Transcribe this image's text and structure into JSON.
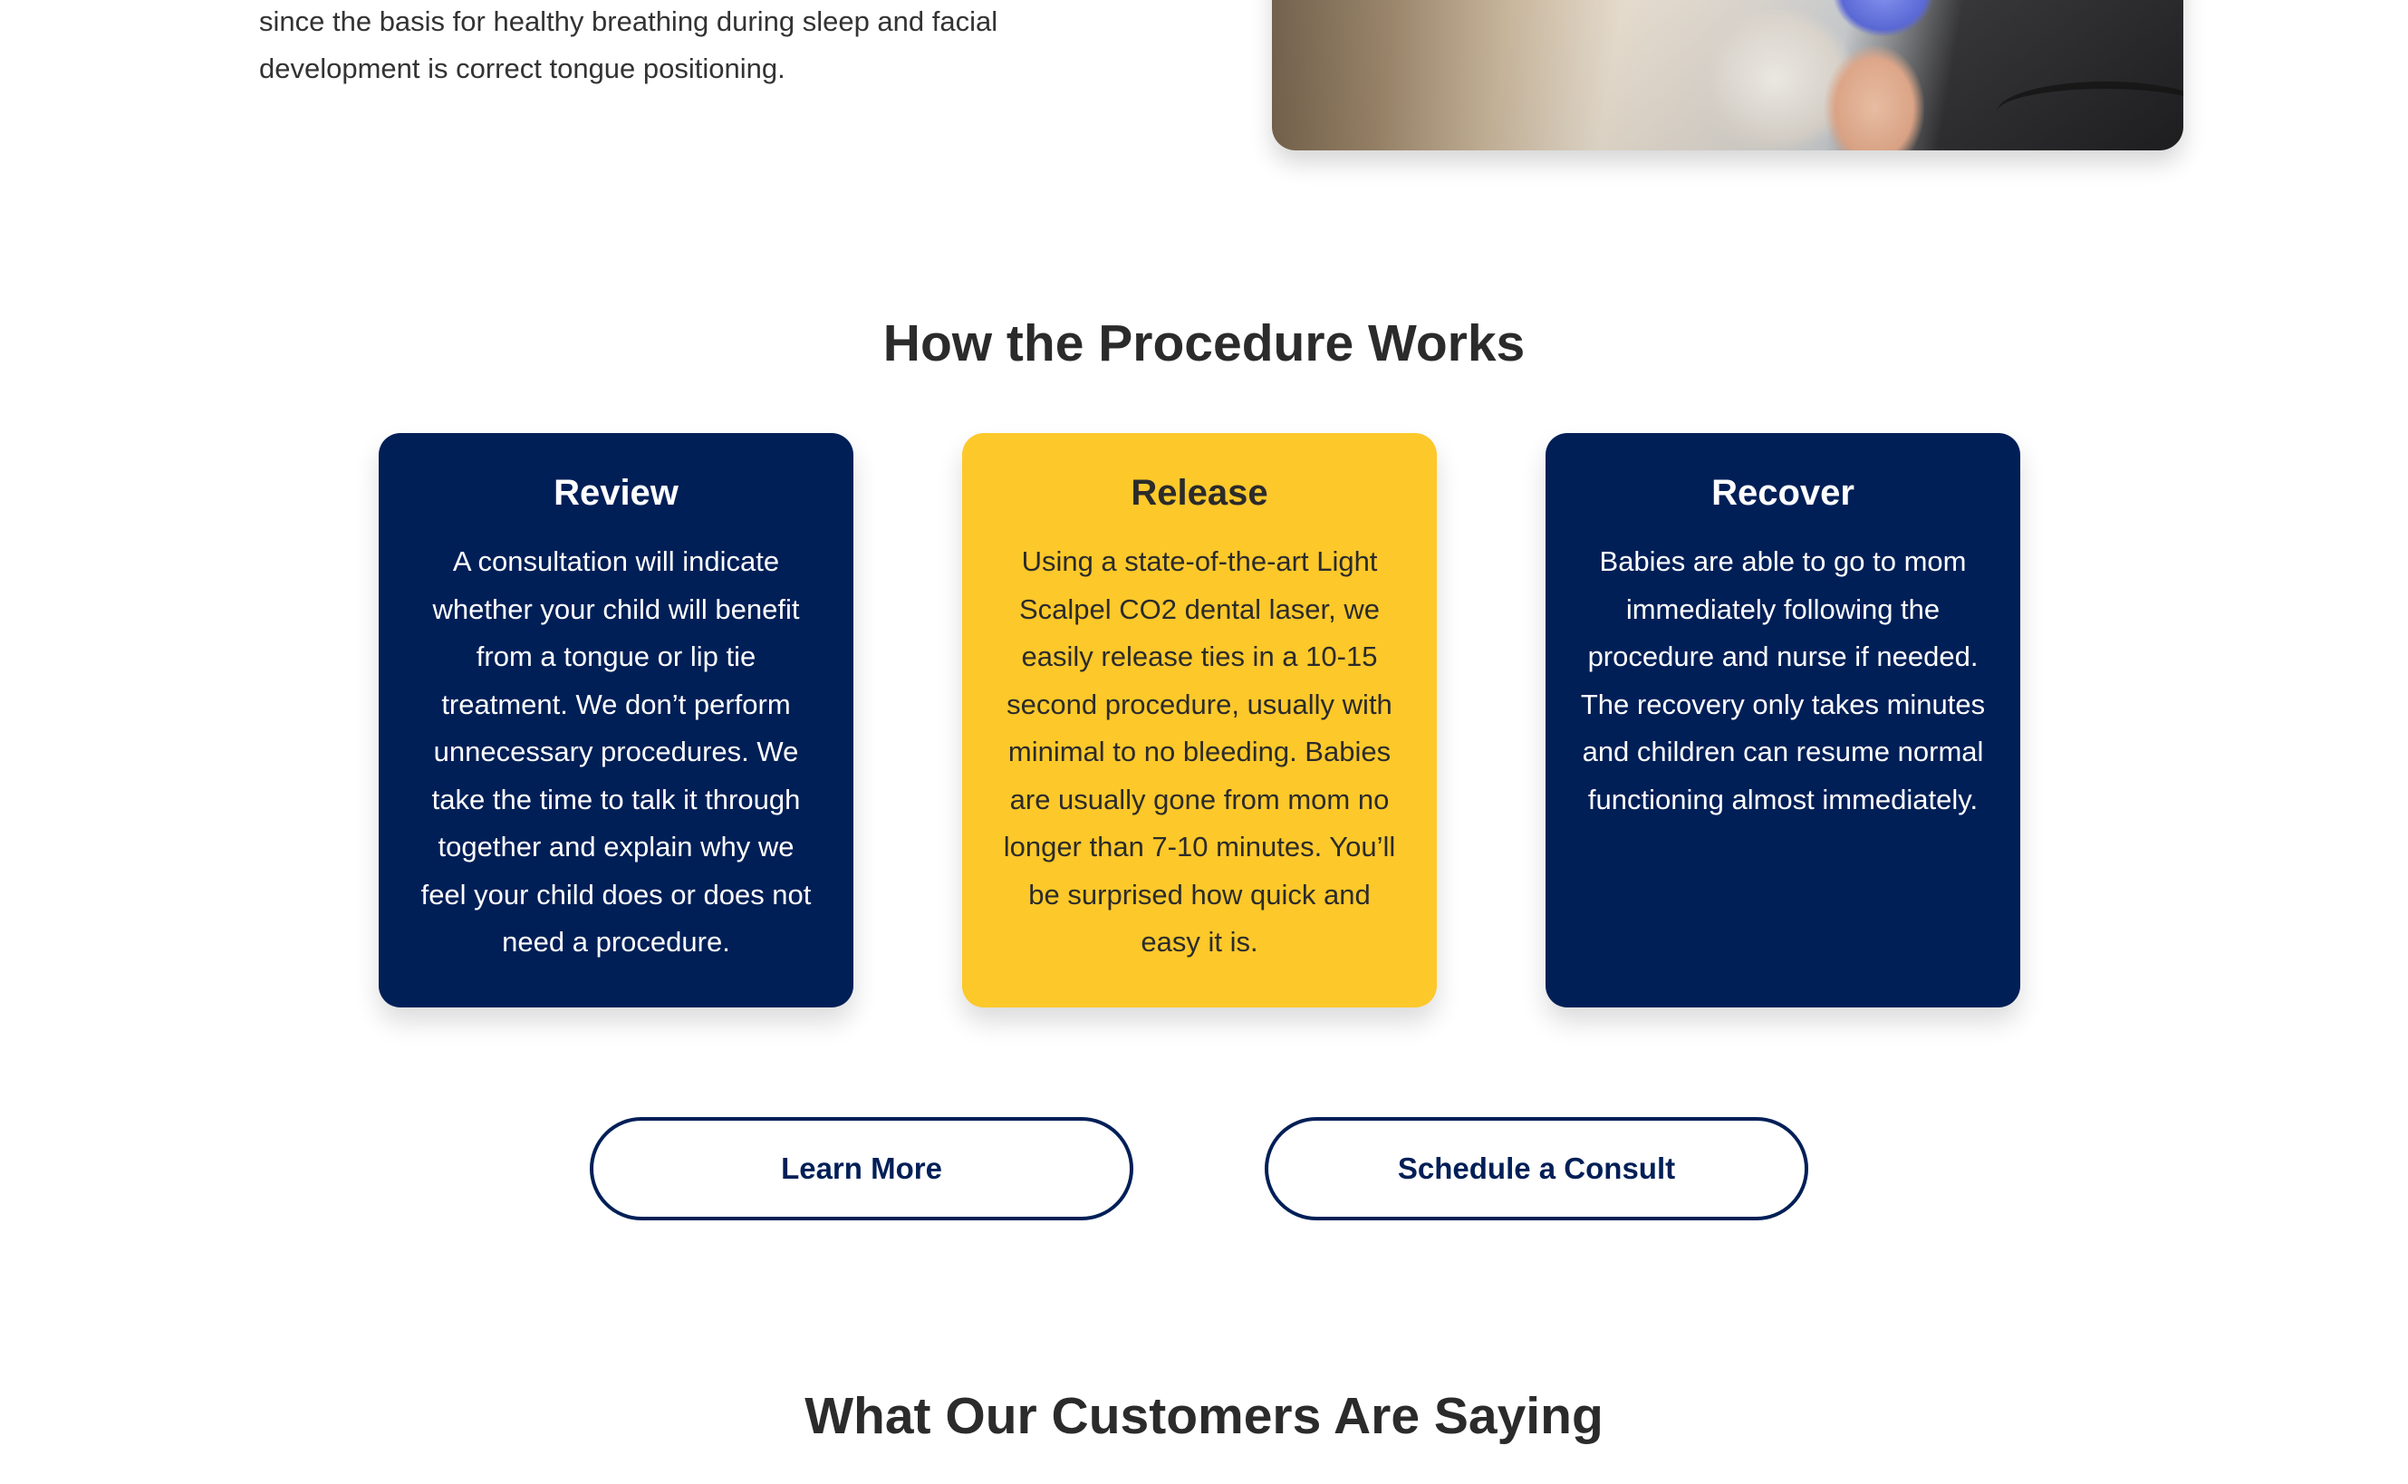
{
  "intro": {
    "text": "since the basis for healthy breathing during sleep and facial development is correct tongue positioning."
  },
  "procedure": {
    "title": "How the Procedure Works",
    "cards": [
      {
        "title": "Review",
        "body": "A consultation will indicate whether your child will benefit from a tongue or lip tie treatment. We don’t perform unnecessary procedures. We take the time to talk it through together and explain why we feel your child does or does not need a procedure."
      },
      {
        "title": "Release",
        "body": "Using a state-of-the-art Light Scalpel CO2 dental laser, we easily release ties in a 10-15 second procedure, usually with minimal to no bleeding. Babies are usually gone from mom no longer than 7-10 minutes. You’ll be surprised how quick and easy it is."
      },
      {
        "title": "Recover",
        "body": "Babies are able to go to mom immediately following the procedure and nurse if needed. The recovery only takes minutes and children can resume normal functioning almost immediately."
      }
    ],
    "buttons": {
      "learn_more": "Learn More",
      "schedule": "Schedule a Consult"
    }
  },
  "testimonials": {
    "title": "What Our Customers Are Saying"
  },
  "colors": {
    "navy": "#001f57",
    "gold": "#fdc82a",
    "text_dark": "#2b2b2b"
  }
}
